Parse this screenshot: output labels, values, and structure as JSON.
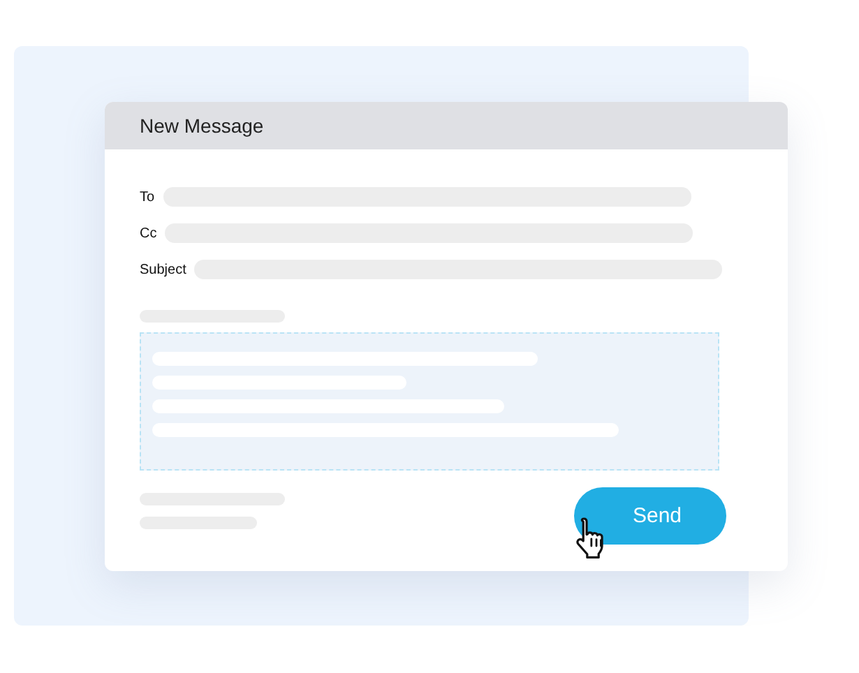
{
  "window": {
    "title": "New Message"
  },
  "fields": [
    {
      "label": "To"
    },
    {
      "label": "Cc"
    },
    {
      "label": "Subject"
    }
  ],
  "send_button": {
    "label": "Send"
  }
}
